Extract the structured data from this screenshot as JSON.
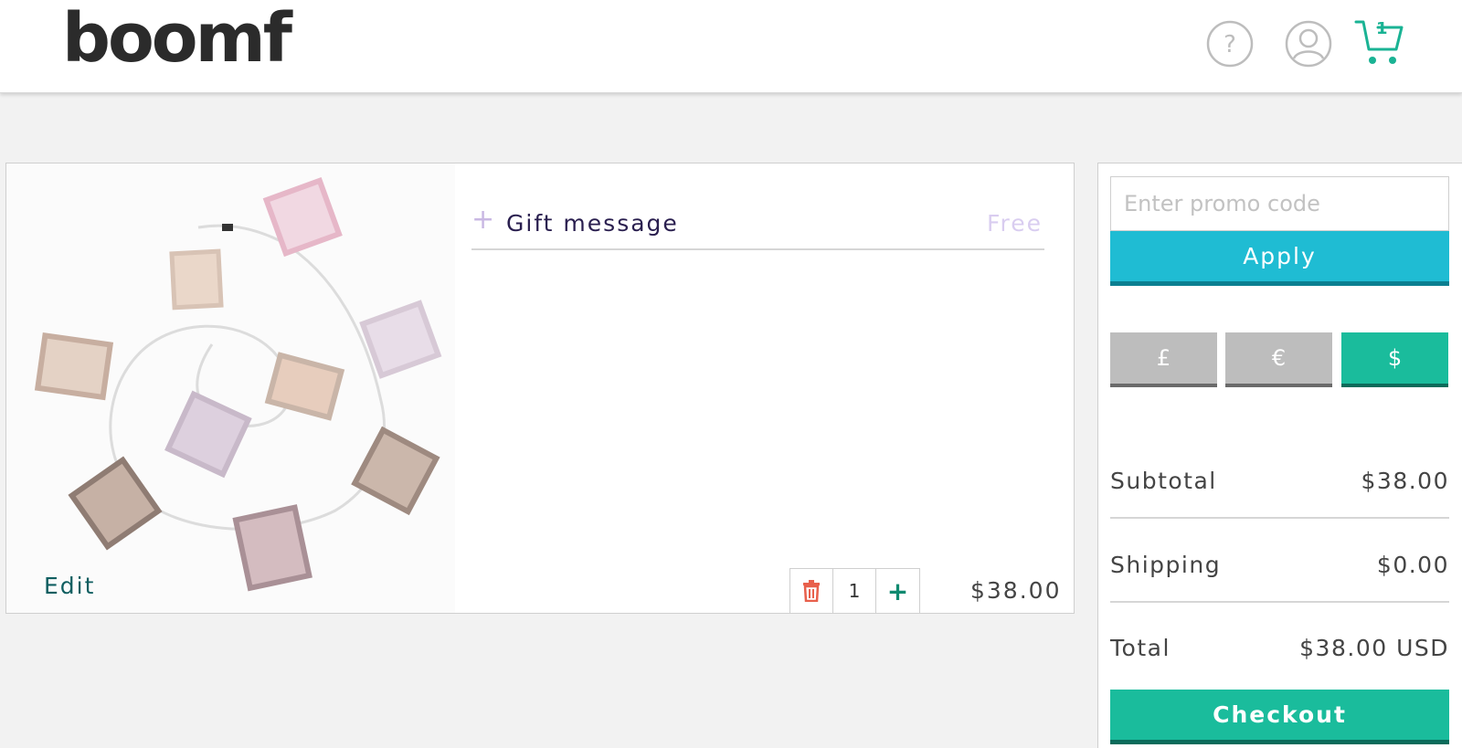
{
  "header": {
    "logo_text": "boomf",
    "cart_count": "1",
    "icons": [
      "help-icon",
      "user-icon",
      "cart-icon"
    ]
  },
  "cart_item": {
    "edit_label": "Edit",
    "gift_message": {
      "plus": "+",
      "label": "Gift message",
      "price": "Free"
    },
    "quantity": "1",
    "plus_label": "+",
    "price": "$38.00"
  },
  "summary": {
    "promo_placeholder": "Enter promo code",
    "apply_label": "Apply",
    "currencies": [
      {
        "label": "£",
        "selected": false
      },
      {
        "label": "€",
        "selected": false
      },
      {
        "label": "$",
        "selected": true
      }
    ],
    "subtotal_label": "Subtotal",
    "subtotal_value": "$38.00",
    "shipping_label": "Shipping",
    "shipping_value": "$0.00",
    "total_label": "Total",
    "total_value": "$38.00 USD",
    "checkout_label": "Checkout"
  },
  "colors": {
    "accent_teal": "#1abc9c",
    "apply_blue": "#1fbcd3",
    "delete_red": "#e8604c"
  }
}
